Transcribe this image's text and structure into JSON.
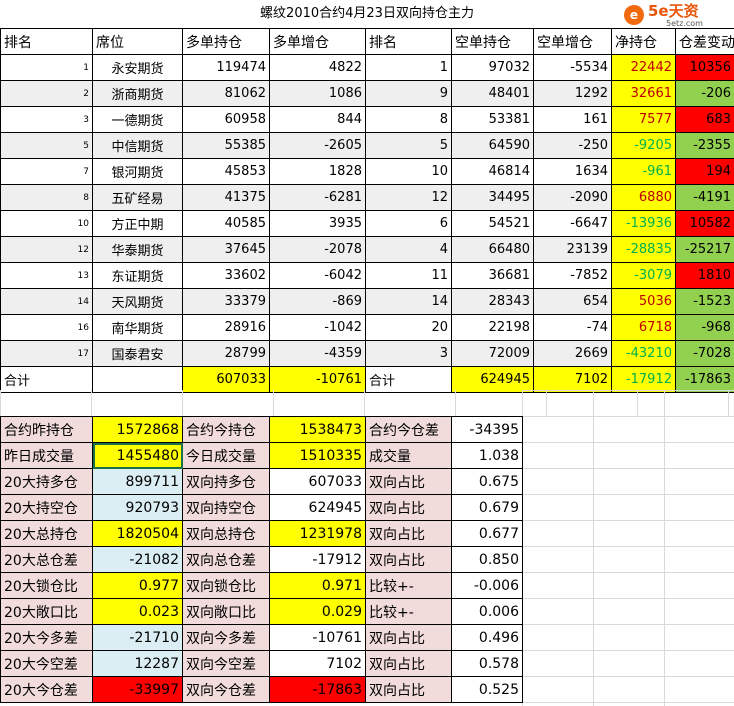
{
  "title": "螺纹2010合约4月23日双向持仓主力",
  "logo": {
    "brand": "5e天资",
    "url": "5etz.com"
  },
  "headers": [
    "排名",
    "席位",
    "多单持仓",
    "多单增仓",
    "排名",
    "空单持仓",
    "空单增仓",
    "净持仓",
    "仓差变动"
  ],
  "rows": [
    {
      "rank": "1",
      "name": "永安期货",
      "long": "119474",
      "long_chg": "4822",
      "srank": "1",
      "short": "97032",
      "short_chg": "-5534",
      "net": "22442",
      "diff": "10356"
    },
    {
      "rank": "2",
      "name": "浙商期货",
      "long": "81062",
      "long_chg": "1086",
      "srank": "9",
      "short": "48401",
      "short_chg": "1292",
      "net": "32661",
      "diff": "-206"
    },
    {
      "rank": "3",
      "name": "一德期货",
      "long": "60958",
      "long_chg": "844",
      "srank": "8",
      "short": "53381",
      "short_chg": "161",
      "net": "7577",
      "diff": "683"
    },
    {
      "rank": "5",
      "name": "中信期货",
      "long": "55385",
      "long_chg": "-2605",
      "srank": "5",
      "short": "64590",
      "short_chg": "-250",
      "net": "-9205",
      "diff": "-2355"
    },
    {
      "rank": "7",
      "name": "银河期货",
      "long": "45853",
      "long_chg": "1828",
      "srank": "10",
      "short": "46814",
      "short_chg": "1634",
      "net": "-961",
      "diff": "194"
    },
    {
      "rank": "8",
      "name": "五矿经易",
      "long": "41375",
      "long_chg": "-6281",
      "srank": "12",
      "short": "34495",
      "short_chg": "-2090",
      "net": "6880",
      "diff": "-4191"
    },
    {
      "rank": "10",
      "name": "方正中期",
      "long": "40585",
      "long_chg": "3935",
      "srank": "6",
      "short": "54521",
      "short_chg": "-6647",
      "net": "-13936",
      "diff": "10582"
    },
    {
      "rank": "12",
      "name": "华泰期货",
      "long": "37645",
      "long_chg": "-2078",
      "srank": "4",
      "short": "66480",
      "short_chg": "23139",
      "net": "-28835",
      "diff": "-25217"
    },
    {
      "rank": "13",
      "name": "东证期货",
      "long": "33602",
      "long_chg": "-6042",
      "srank": "11",
      "short": "36681",
      "short_chg": "-7852",
      "net": "-3079",
      "diff": "1810"
    },
    {
      "rank": "14",
      "name": "天风期货",
      "long": "33379",
      "long_chg": "-869",
      "srank": "14",
      "short": "28343",
      "short_chg": "654",
      "net": "5036",
      "diff": "-1523"
    },
    {
      "rank": "16",
      "name": "南华期货",
      "long": "28916",
      "long_chg": "-1042",
      "srank": "20",
      "short": "22198",
      "short_chg": "-74",
      "net": "6718",
      "diff": "-968"
    },
    {
      "rank": "17",
      "name": "国泰君安",
      "long": "28799",
      "long_chg": "-4359",
      "srank": "3",
      "short": "72009",
      "short_chg": "2669",
      "net": "-43210",
      "diff": "-7028"
    }
  ],
  "total": {
    "label": "合计",
    "long": "607033",
    "long_chg": "-10761",
    "label2": "合计",
    "short": "624945",
    "short_chg": "7102",
    "net": "-17912",
    "diff": "-17863"
  },
  "summary": [
    {
      "l1": "合约昨持仓",
      "v1": "1572868",
      "l2": "合约今持仓",
      "v2": "1538473",
      "l3": "合约今仓差",
      "v3": "-34395"
    },
    {
      "l1": "昨日成交量",
      "v1": "1455480",
      "l2": "今日成交量",
      "v2": "1510335",
      "l3": "成交量",
      "v3": "1.038"
    },
    {
      "l1": "20大持多仓",
      "v1": "899711",
      "l2": "双向持多仓",
      "v2": "607033",
      "l3": "双向占比",
      "v3": "0.675"
    },
    {
      "l1": "20大持空仓",
      "v1": "920793",
      "l2": "双向持空仓",
      "v2": "624945",
      "l3": "双向占比",
      "v3": "0.679"
    },
    {
      "l1": "20大总持仓",
      "v1": "1820504",
      "l2": "双向总持仓",
      "v2": "1231978",
      "l3": "双向占比",
      "v3": "0.677"
    },
    {
      "l1": "20大总仓差",
      "v1": "-21082",
      "l2": "双向总仓差",
      "v2": "-17912",
      "l3": "双向占比",
      "v3": "0.850"
    },
    {
      "l1": "20大锁仓比",
      "v1": "0.977",
      "l2": "双向锁仓比",
      "v2": "0.971",
      "l3": "比较+-",
      "v3": "-0.006"
    },
    {
      "l1": "20大敞口比",
      "v1": "0.023",
      "l2": "双向敞口比",
      "v2": "0.029",
      "l3": "比较+-",
      "v3": "0.006"
    },
    {
      "l1": "20大今多差",
      "v1": "-21710",
      "l2": "双向今多差",
      "v2": "-10761",
      "l3": "双向占比",
      "v3": "0.496"
    },
    {
      "l1": "20大今空差",
      "v1": "12287",
      "l2": "双向今空差",
      "v2": "7102",
      "l3": "双向占比",
      "v3": "0.578"
    },
    {
      "l1": "20大今仓差",
      "v1": "-33997",
      "l2": "双向今仓差",
      "v2": "-17863",
      "l3": "双向占比",
      "v3": "0.525"
    }
  ],
  "colors": {
    "yellow": "#ffff00",
    "red": "#ff0000",
    "green": "#92d050",
    "pink": "#f2dcdb",
    "blue": "#daeef3"
  }
}
